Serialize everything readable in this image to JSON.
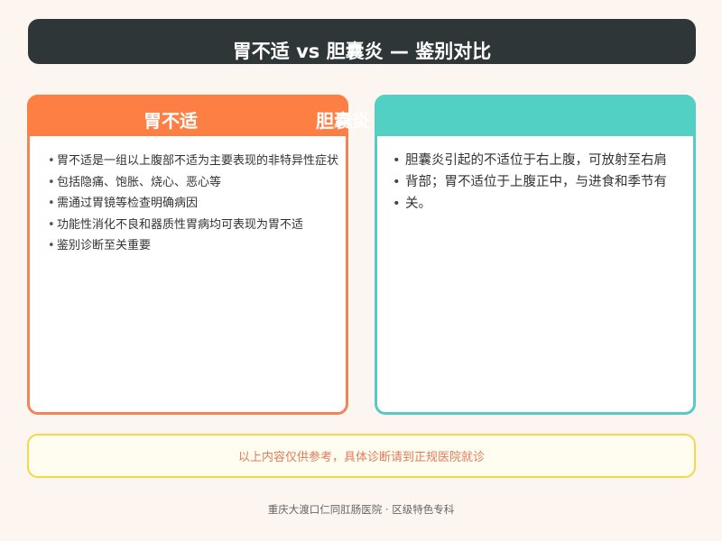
{
  "title": "胃不适 vs 胆囊炎 — 鉴别对比",
  "left_card": {
    "title": "胃不适",
    "items": [
      "胃不适是一组以上腹部不适为主要表现的非特异性症状",
      "包括隐痛、饱胀、烧心、恶心等",
      "需通过胃镜等检查明确病因",
      "功能性消化不良和器质性胃病均可表现为胃不适",
      "鉴别诊断至关重要"
    ]
  },
  "right_card": {
    "title": "胆囊炎",
    "items": [
      "胆囊炎引起的不适位于右上腹，可放射至右肩",
      "背部；胃不适位于上腹正中，与进食和季节有",
      "关。"
    ]
  },
  "note": "以上内容仅供参考，具体诊断请到正规医院就诊",
  "footer": "重庆大渡口仁同肛肠医院 · 区级特色专科",
  "colors": {
    "title_bar": "#2f3638",
    "left_accent": "#fe7f44",
    "right_accent": "#52d0c4",
    "note_border": "#f5d74a",
    "note_text": "#e07b5a",
    "background": "#fdf6f0"
  }
}
